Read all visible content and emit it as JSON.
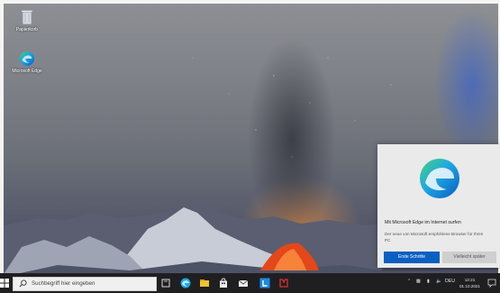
{
  "desktop": {
    "icons": [
      {
        "label": "Papierkorb",
        "icon": "recycle-bin-icon"
      },
      {
        "label": "Microsoft Edge",
        "icon": "edge-icon"
      }
    ]
  },
  "notification": {
    "title": "Mit Microsoft Edge im Internet surfen",
    "description": "Der neue von Microsoft empfohlene Browser für Ihren PC",
    "primary_label": "Erste Schritte",
    "secondary_label": "Vielleicht später"
  },
  "taskbar": {
    "search_placeholder": "Suchbegriff hier eingeben",
    "apps": [
      "task-view-icon",
      "edge-icon",
      "file-explorer-icon",
      "store-icon",
      "mail-icon",
      "app-l-icon",
      "app-red-icon"
    ],
    "tray_language": "DEU",
    "time": "12:21",
    "date": "01.10.2021"
  },
  "colors": {
    "accent": "#0a5fc2",
    "taskbar": "#1f1f22"
  }
}
